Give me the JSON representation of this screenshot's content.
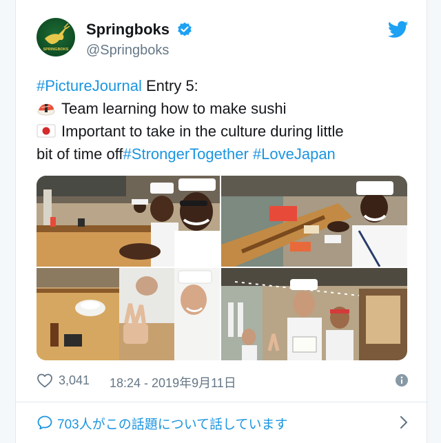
{
  "account": {
    "display_name": "Springboks",
    "handle": "@Springboks",
    "avatar_text": "SPRINGBOKS",
    "verified": true
  },
  "tweet": {
    "line1_hashtag": "#PictureJournal",
    "line1_rest": " Entry 5:",
    "line2": "Team learning how to make sushi",
    "line3": "Important to take in the culture during little",
    "line4_text": "bit of time off",
    "line4_hashtag1": "#StrongerTogether",
    "line4_space": " ",
    "line4_hashtag2": "#LoveJapan"
  },
  "media": {
    "photos": [
      "sushi-bar-selfie",
      "sushi-chef-smile",
      "sushi-counter-peace-sign",
      "sushi-restaurant-group"
    ]
  },
  "meta": {
    "like_count": "3,041",
    "timestamp": "18:24 - 2019年9月11日"
  },
  "replies": {
    "label": "703人がこの話題について話しています"
  },
  "colors": {
    "link": "#1b95e0",
    "text": "#14171a",
    "muted": "#657786",
    "background": "#ffffff",
    "avatar": "#0f4d24"
  },
  "icons": [
    "verified-badge-icon",
    "twitter-bird-icon",
    "sushi-emoji-icon",
    "japan-flag-emoji-icon",
    "heart-icon",
    "info-icon",
    "speech-bubble-icon",
    "chevron-right-icon"
  ]
}
